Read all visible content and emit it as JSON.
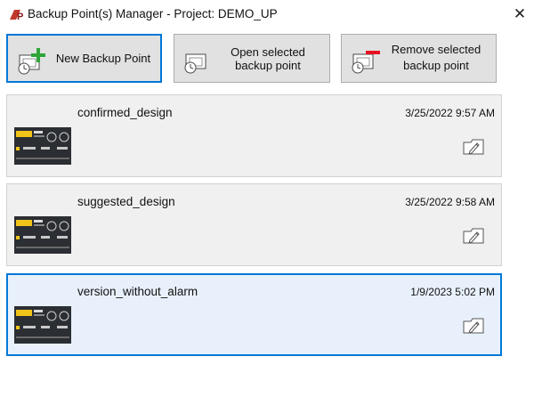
{
  "window": {
    "title": "Backup Point(s) Manager - Project: DEMO_UP",
    "app_icon": "tp-app-icon",
    "close_icon": "close-icon"
  },
  "toolbar": {
    "new_label": "New Backup Point",
    "open_label_1": "Open selected",
    "open_label_2": "backup point",
    "remove_label_1": "Remove selected",
    "remove_label_2": "backup point"
  },
  "colors": {
    "accent": "#0078d7",
    "add": "#2fa53a",
    "remove": "#e81123"
  },
  "backups": [
    {
      "name": "confirmed_design",
      "date": "3/25/2022 9:57 AM",
      "selected": false
    },
    {
      "name": "suggested_design",
      "date": "3/25/2022 9:58 AM",
      "selected": false
    },
    {
      "name": "version_without_alarm",
      "date": "1/9/2023 5:02 PM",
      "selected": true
    }
  ]
}
